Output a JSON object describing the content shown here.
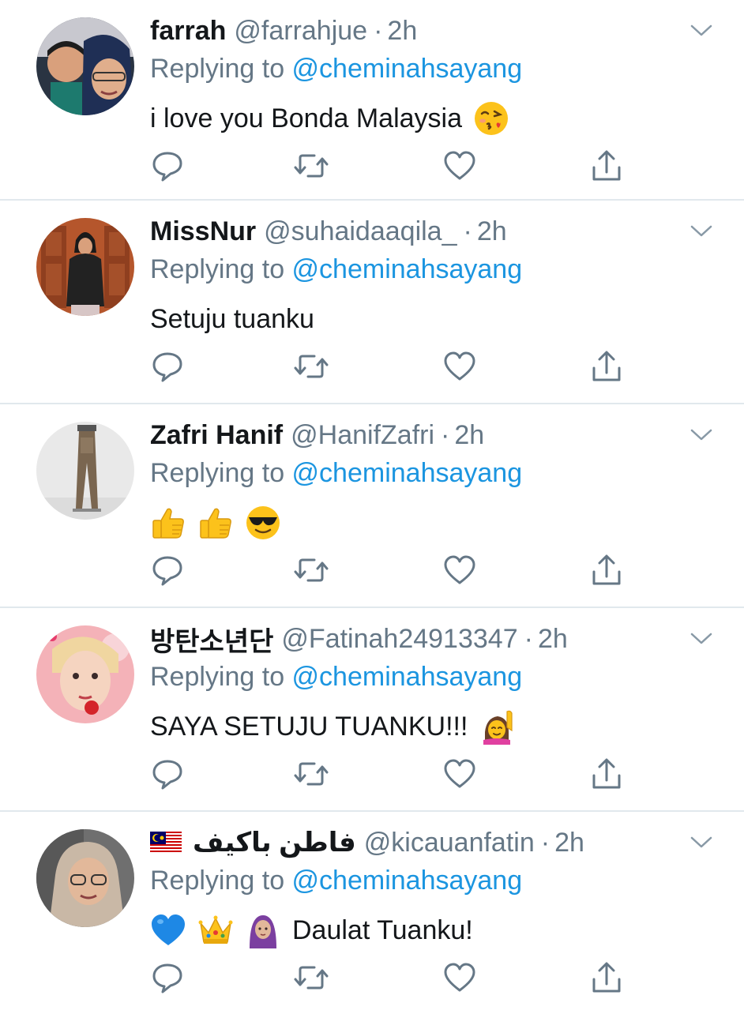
{
  "tweets": [
    {
      "name": "farrah",
      "handle": "@farrahjue",
      "dot": "·",
      "time": "2h",
      "replying_prefix": "Replying to ",
      "replying_to": "@cheminahsayang",
      "text": "i love you Bonda Malaysia",
      "emojis": [
        "face-blowing-kiss-emoji"
      ]
    },
    {
      "name": "MissNur",
      "handle": "@suhaidaaqila_",
      "dot": "·",
      "time": "2h",
      "replying_prefix": "Replying to ",
      "replying_to": "@cheminahsayang",
      "text": "Setuju tuanku",
      "emojis": []
    },
    {
      "name": "Zafri Hanif",
      "handle": "@HanifZafri",
      "dot": "·",
      "time": "2h",
      "replying_prefix": "Replying to ",
      "replying_to": "@cheminahsayang",
      "text": "",
      "emojis": [
        "thumbs-up-emoji",
        "thumbs-up-emoji",
        "sunglasses-face-emoji"
      ]
    },
    {
      "name": "방탄소년단",
      "handle": "@Fatinah24913347",
      "dot": "·",
      "time": "2h",
      "replying_prefix": "Replying to ",
      "replying_to": "@cheminahsayang",
      "text": "SAYA SETUJU TUANKU!!!",
      "emojis": [
        "person-raising-hand-emoji"
      ]
    },
    {
      "name": "فاطن باكيف",
      "handle": "@kicauanfatin",
      "dot": "·",
      "time": "2h",
      "replying_prefix": "Replying to ",
      "replying_to": "@cheminahsayang",
      "text": "Daulat Tuanku!",
      "emojis": [
        "blue-heart-emoji",
        "crown-emoji",
        "woman-with-headscarf-emoji"
      ],
      "flag": "malaysia-flag"
    }
  ],
  "colors": {
    "text": "#14171a",
    "secondary": "#657786",
    "link": "#1b95e0",
    "divider": "#e1e8ed"
  }
}
